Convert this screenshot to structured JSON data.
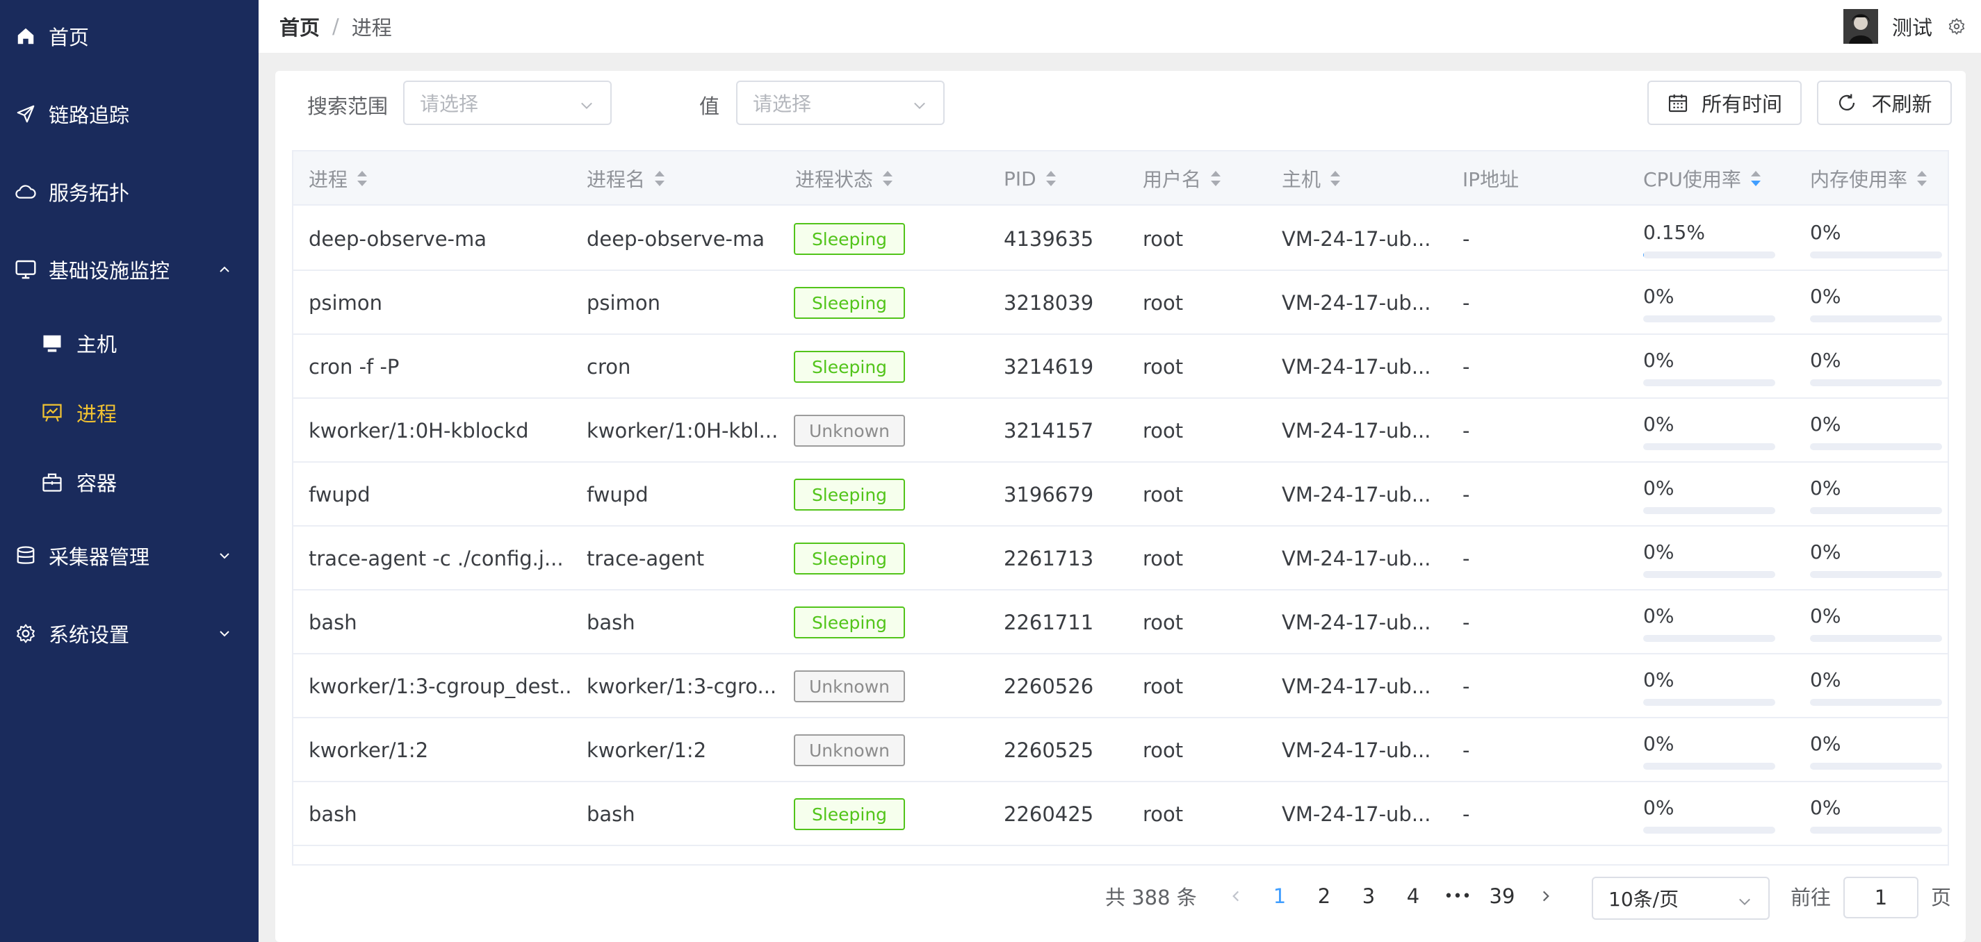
{
  "sidebar": {
    "items": [
      {
        "label": "首页",
        "icon": "home-icon"
      },
      {
        "label": "链路追踪",
        "icon": "send-icon"
      },
      {
        "label": "服务拓扑",
        "icon": "cloud-icon"
      },
      {
        "label": "基础设施监控",
        "icon": "monitor-icon",
        "expanded": true
      },
      {
        "label": "采集器管理",
        "icon": "database-icon",
        "expanded": false
      },
      {
        "label": "系统设置",
        "icon": "gear-icon",
        "expanded": false
      }
    ],
    "subitems": [
      {
        "label": "主机",
        "icon": "host-icon"
      },
      {
        "label": "进程",
        "icon": "process-icon",
        "active": true
      },
      {
        "label": "容器",
        "icon": "container-icon"
      }
    ],
    "active_color": "#f1c232",
    "background": "#1a2b5c"
  },
  "header": {
    "breadcrumb_home": "首页",
    "breadcrumb_sep": "/",
    "breadcrumb_current": "进程",
    "username": "测试"
  },
  "filters": {
    "scope_label": "搜索范围",
    "scope_placeholder": "请选择",
    "value_label": "值",
    "value_placeholder": "请选择",
    "time_button": "所有时间",
    "refresh_button": "不刷新"
  },
  "table": {
    "columns": [
      "进程",
      "进程名",
      "进程状态",
      "PID",
      "用户名",
      "主机",
      "IP地址",
      "CPU使用率",
      "内存使用率"
    ],
    "rows": [
      {
        "process": "deep-observe-ma",
        "name": "deep-observe-ma",
        "status": "Sleeping",
        "pid": "4139635",
        "user": "root",
        "host": "VM-24-17-ub...",
        "ip": "-",
        "cpu": "0.15%",
        "cpu_value": 0.15,
        "mem": "0%",
        "mem_value": 0
      },
      {
        "process": "psimon",
        "name": "psimon",
        "status": "Sleeping",
        "pid": "3218039",
        "user": "root",
        "host": "VM-24-17-ub...",
        "ip": "-",
        "cpu": "0%",
        "cpu_value": 0,
        "mem": "0%",
        "mem_value": 0
      },
      {
        "process": "cron  -f -P",
        "name": "cron",
        "status": "Sleeping",
        "pid": "3214619",
        "user": "root",
        "host": "VM-24-17-ub...",
        "ip": "-",
        "cpu": "0%",
        "cpu_value": 0,
        "mem": "0%",
        "mem_value": 0
      },
      {
        "process": "kworker/1:0H-kblockd",
        "name": "kworker/1:0H-kbl...",
        "status": "Unknown",
        "pid": "3214157",
        "user": "root",
        "host": "VM-24-17-ub...",
        "ip": "-",
        "cpu": "0%",
        "cpu_value": 0,
        "mem": "0%",
        "mem_value": 0
      },
      {
        "process": "fwupd",
        "name": "fwupd",
        "status": "Sleeping",
        "pid": "3196679",
        "user": "root",
        "host": "VM-24-17-ub...",
        "ip": "-",
        "cpu": "0%",
        "cpu_value": 0,
        "mem": "0%",
        "mem_value": 0
      },
      {
        "process": "trace-agent  -c ./config.j...",
        "name": "trace-agent",
        "status": "Sleeping",
        "pid": "2261713",
        "user": "root",
        "host": "VM-24-17-ub...",
        "ip": "-",
        "cpu": "0%",
        "cpu_value": 0,
        "mem": "0%",
        "mem_value": 0
      },
      {
        "process": "bash",
        "name": "bash",
        "status": "Sleeping",
        "pid": "2261711",
        "user": "root",
        "host": "VM-24-17-ub...",
        "ip": "-",
        "cpu": "0%",
        "cpu_value": 0,
        "mem": "0%",
        "mem_value": 0
      },
      {
        "process": "kworker/1:3-cgroup_dest...",
        "name": "kworker/1:3-cgro...",
        "status": "Unknown",
        "pid": "2260526",
        "user": "root",
        "host": "VM-24-17-ub...",
        "ip": "-",
        "cpu": "0%",
        "cpu_value": 0,
        "mem": "0%",
        "mem_value": 0
      },
      {
        "process": "kworker/1:2",
        "name": "kworker/1:2",
        "status": "Unknown",
        "pid": "2260525",
        "user": "root",
        "host": "VM-24-17-ub...",
        "ip": "-",
        "cpu": "0%",
        "cpu_value": 0,
        "mem": "0%",
        "mem_value": 0
      },
      {
        "process": "bash",
        "name": "bash",
        "status": "Sleeping",
        "pid": "2260425",
        "user": "root",
        "host": "VM-24-17-ub...",
        "ip": "-",
        "cpu": "0%",
        "cpu_value": 0,
        "mem": "0%",
        "mem_value": 0
      }
    ]
  },
  "pagination": {
    "total": "共 388 条",
    "pages": [
      "1",
      "2",
      "3",
      "4",
      "39"
    ],
    "current": "1",
    "ellipsis": "•••",
    "page_size": "10条/页",
    "goto_label": "前往",
    "goto_value": "1",
    "page_suffix": "页"
  },
  "colors": {
    "sleeping": "#52c41a",
    "unknown": "#8c8c8c",
    "accent": "#409eff"
  }
}
